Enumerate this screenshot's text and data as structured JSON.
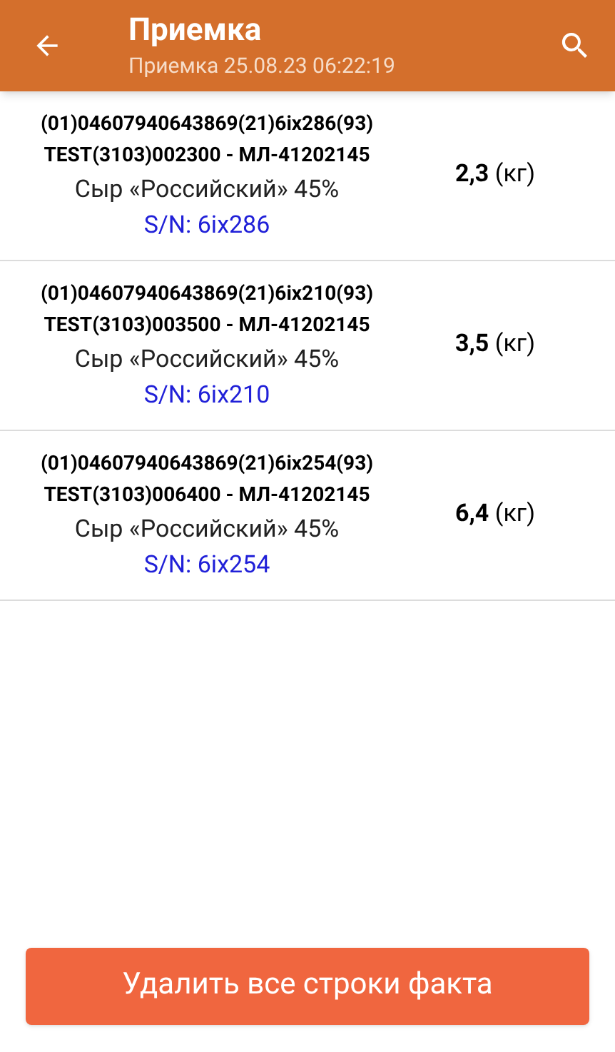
{
  "app_bar": {
    "title": "Приемка",
    "subtitle": "Приемка 25.08.23 06:22:19"
  },
  "items": [
    {
      "code_line_1": "(01)04607940643869(21)6ix286(93)",
      "code_line_2": "TEST(3103)002300 - МЛ-41202145",
      "name": "Сыр «Российский» 45%",
      "serial": "S/N: 6ix286",
      "quantity": "**2,3** (кг)"
    },
    {
      "code_line_1": "(01)04607940643869(21)6ix210(93)",
      "code_line_2": "TEST(3103)003500 - МЛ-41202145",
      "name": "Сыр «Российский» 45%",
      "serial": "S/N: 6ix210",
      "quantity": "**3,5** (кг)"
    },
    {
      "code_line_1": "(01)04607940643869(21)6ix254(93)",
      "code_line_2": "TEST(3103)006400 - МЛ-41202145",
      "name": "Сыр «Российский» 45%",
      "serial": "S/N: 6ix254",
      "quantity": "**6,4** (кг)"
    }
  ],
  "delete_button": "Удалить все строки факта"
}
